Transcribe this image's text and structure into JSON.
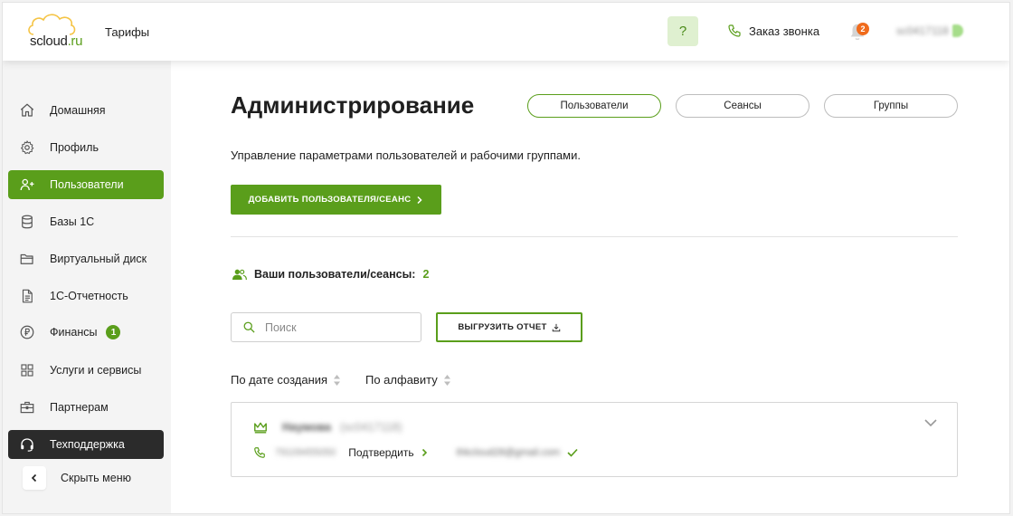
{
  "header": {
    "logo_main": "scloud",
    "logo_suffix": ".ru",
    "nav_tariffs": "Тарифы",
    "help_label": "?",
    "callback_label": "Заказ звонка",
    "notifications_count": "2",
    "account_id": "sc0417118"
  },
  "sidebar": {
    "items": [
      {
        "label": "Домашняя"
      },
      {
        "label": "Профиль"
      },
      {
        "label": "Пользователи"
      },
      {
        "label": "Базы 1С"
      },
      {
        "label": "Виртуальный диск"
      },
      {
        "label": "1С-Отчетность"
      },
      {
        "label": "Финансы",
        "badge": "1"
      },
      {
        "label": "Услуги и сервисы"
      },
      {
        "label": "Партнерам"
      },
      {
        "label": "Техподдержка"
      }
    ],
    "hide_menu_label": "Скрыть меню"
  },
  "main": {
    "title": "Администрирование",
    "tabs": [
      {
        "label": "Пользователи"
      },
      {
        "label": "Сеансы"
      },
      {
        "label": "Группы"
      }
    ],
    "description": "Управление параметрами пользователей и рабочими группами.",
    "add_button_label": "ДОБАВИТЬ ПОЛЬЗОВАТЕЛЯ/СЕАНС",
    "users_count_label": "Ваши пользователи/сеансы:",
    "users_count_value": "2",
    "search_placeholder": "Поиск",
    "search_value": "",
    "export_button_label": "ВЫГРУЗИТЬ ОТЧЕТ",
    "sort_by_date_label": "По дате создания",
    "sort_by_alpha_label": "По алфавиту",
    "user_card": {
      "name": "Наумова",
      "login": "(sc0417118)",
      "phone": "79109455050",
      "confirm_label": "Подтвердить",
      "email": "thkcloud28@gmail.com"
    }
  },
  "colors": {
    "accent": "#5a9e1b",
    "notification_badge": "#f06b1c",
    "help_bg": "#dff0d0",
    "sidebar_bg": "#f4f4f4",
    "support_bg": "#2b2b2b"
  }
}
